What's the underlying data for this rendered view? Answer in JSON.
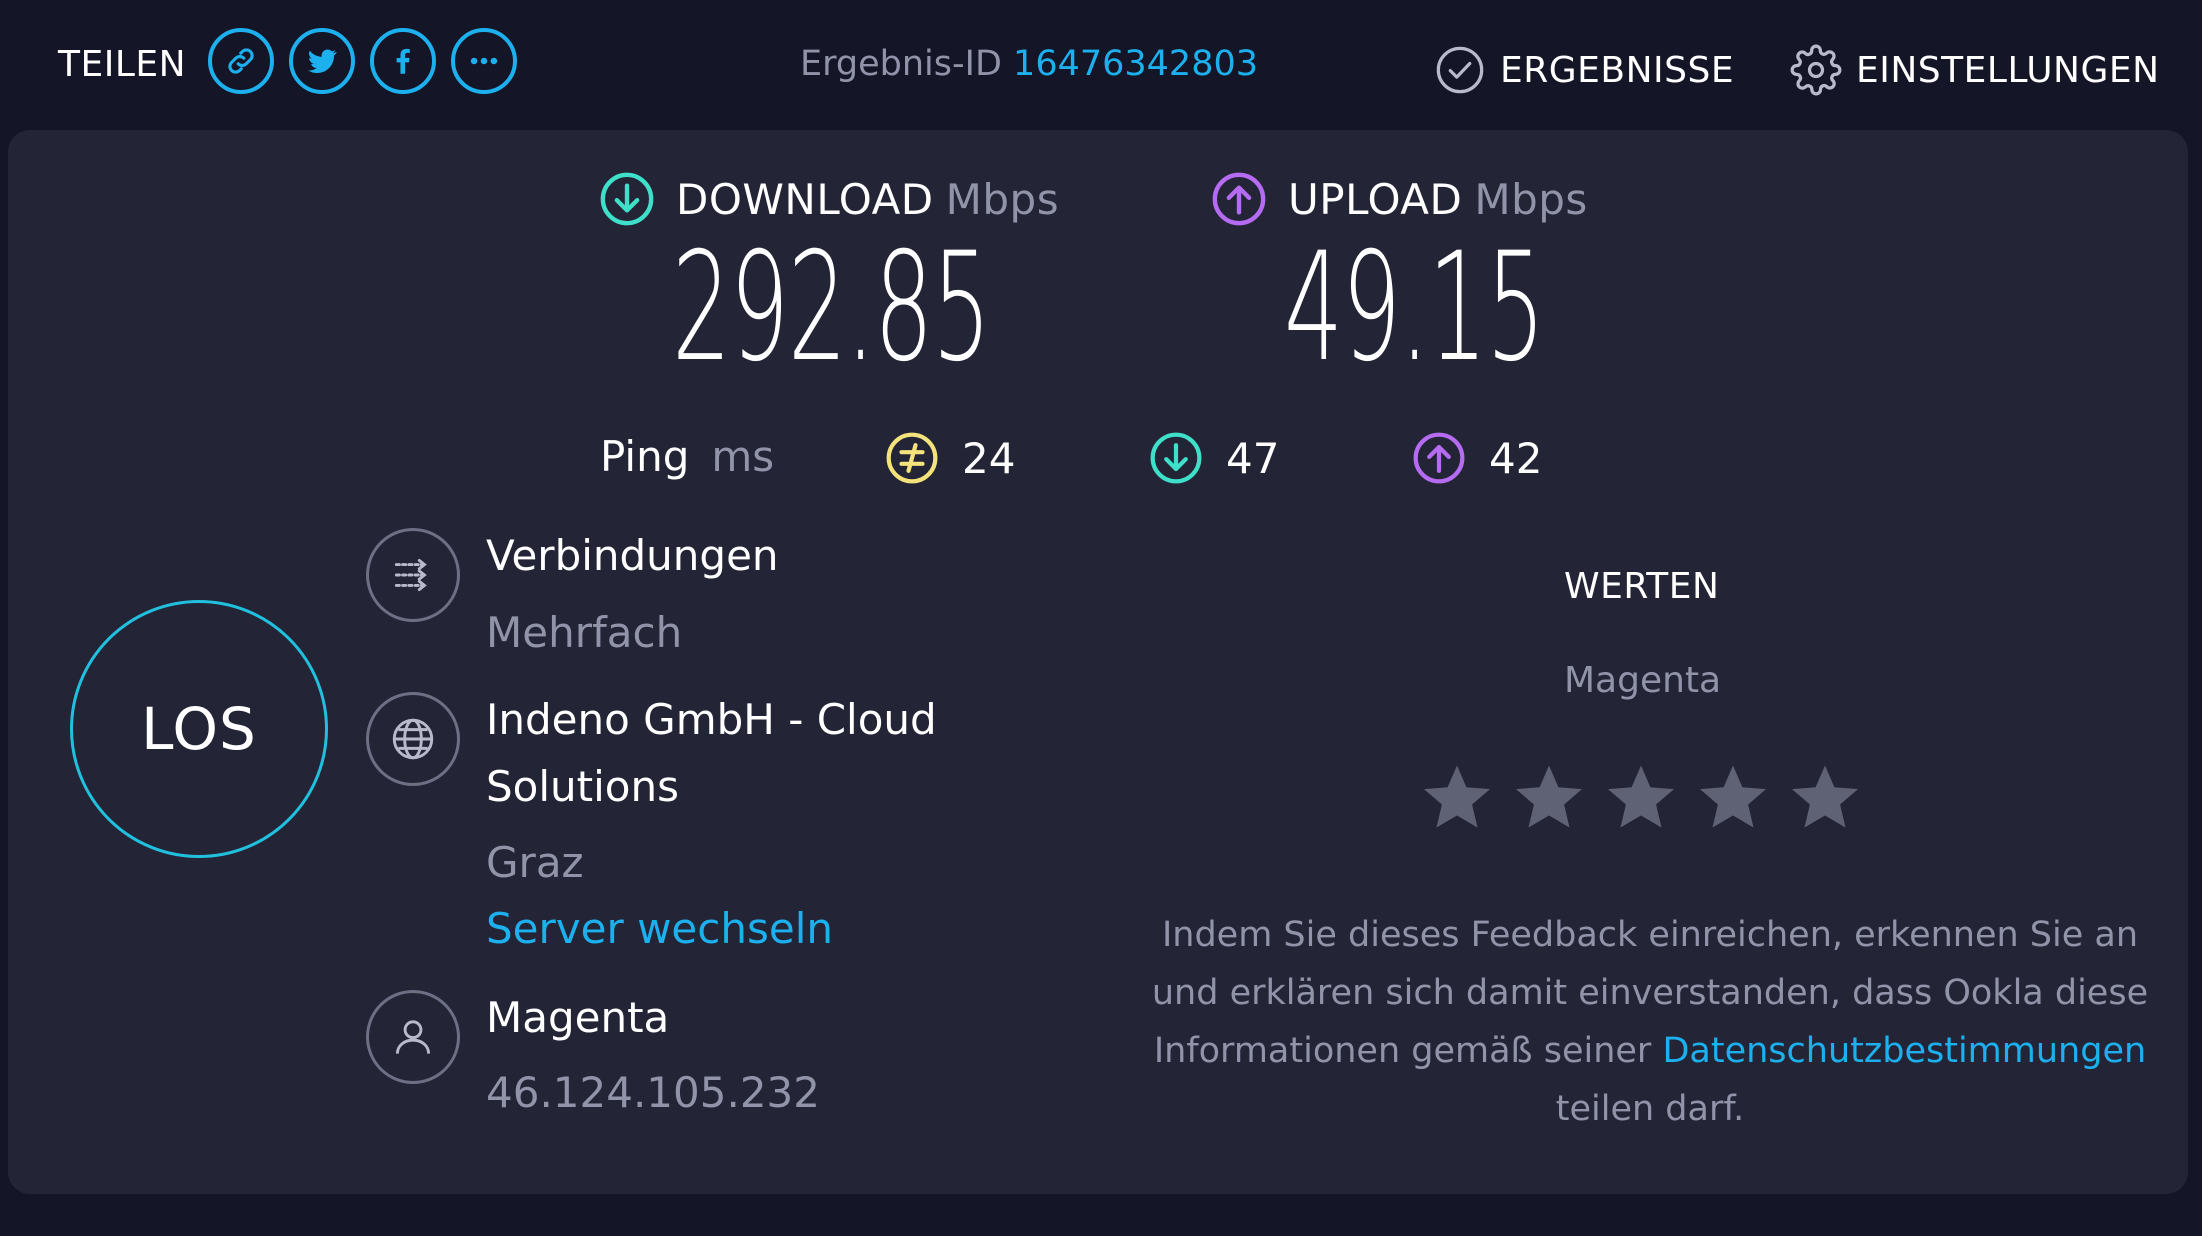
{
  "topbar": {
    "share_label": "TEILEN",
    "result_id_label": "Ergebnis-ID",
    "result_id": "16476342803",
    "results_label": "ERGEBNISSE",
    "settings_label": "EINSTELLUNGEN"
  },
  "download": {
    "label": "DOWNLOAD",
    "unit": "Mbps",
    "value": "292.85",
    "icon": "download-arrow-icon",
    "color": "#3ee0c9"
  },
  "upload": {
    "label": "UPLOAD",
    "unit": "Mbps",
    "value": "49.15",
    "icon": "upload-arrow-icon",
    "color": "#b56cf2"
  },
  "ping": {
    "label": "Ping",
    "unit": "ms",
    "idle": "24",
    "download": "47",
    "upload": "42",
    "idle_color": "#f3e37a"
  },
  "go_button": "LOS",
  "connections": {
    "title": "Verbindungen",
    "value": "Mehrfach"
  },
  "server": {
    "name_line1": "Indeno GmbH - Cloud",
    "name_line2": "Solutions",
    "location": "Graz",
    "change_link": "Server wechseln"
  },
  "isp": {
    "name": "Magenta",
    "ip": "46.124.105.232"
  },
  "rating": {
    "title": "WERTEN",
    "isp": "Magenta",
    "stars": 5,
    "disclaimer_before": "Indem Sie dieses Feedback einreichen, erkennen Sie an und erklären sich damit einverstanden, dass Ookla diese Informationen gemäß seiner",
    "disclaimer_link": "Datenschutzbestimmungen",
    "disclaimer_after": "teilen darf."
  },
  "colors": {
    "accent": "#1cb0ef",
    "background": "#141526",
    "panel": "#232536",
    "muted": "#9193a8"
  }
}
